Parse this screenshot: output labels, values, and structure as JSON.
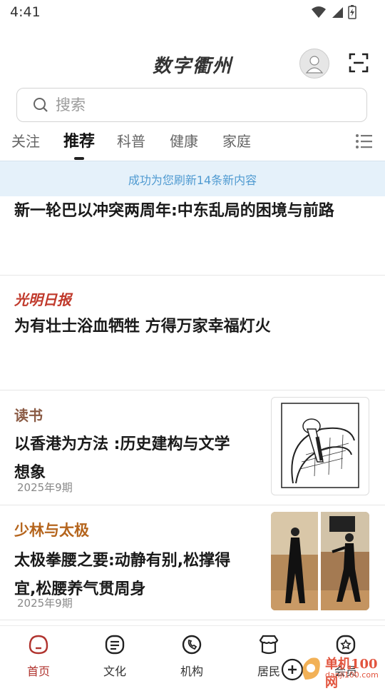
{
  "status_bar": {
    "time": "4:41"
  },
  "header": {
    "title": "数字衢州"
  },
  "search": {
    "placeholder": "搜索"
  },
  "tabs": [
    {
      "label": "关注"
    },
    {
      "label": "推荐",
      "active": true
    },
    {
      "label": "科普"
    },
    {
      "label": "健康"
    },
    {
      "label": "家庭"
    }
  ],
  "refresh_banner": "成功为您刷新14条新内容",
  "articles": [
    {
      "title": "新一轮巴以冲突两周年:中东乱局的困境与前路"
    },
    {
      "source": "光明日报",
      "title": "为有壮士浴血牺牲 方得万家幸福灯火"
    },
    {
      "source": "读书",
      "title_line1": "以香港为方法 :历史建构与文学",
      "title_line2": "想象",
      "date": "2025年9期"
    },
    {
      "source": "少林与太极",
      "title_line1": "太极拳腰之要:动静有别,松撑得",
      "title_line2": "宜,松腰养气贯周身",
      "date": "2025年9期"
    }
  ],
  "bottom_nav": [
    {
      "label": "首页",
      "icon": "home-icon",
      "active": true
    },
    {
      "label": "文化",
      "icon": "culture-icon"
    },
    {
      "label": "机构",
      "icon": "phone-icon"
    },
    {
      "label": "居民",
      "icon": "shop-icon"
    },
    {
      "label": "会员",
      "icon": "member-icon"
    }
  ],
  "watermark": {
    "text": "单机100网",
    "url": "danji100.com"
  },
  "colors": {
    "accent": "#b0332e",
    "banner_bg": "#e5f1fa",
    "banner_text": "#4f9ad1",
    "source_red": "#c0392b"
  }
}
